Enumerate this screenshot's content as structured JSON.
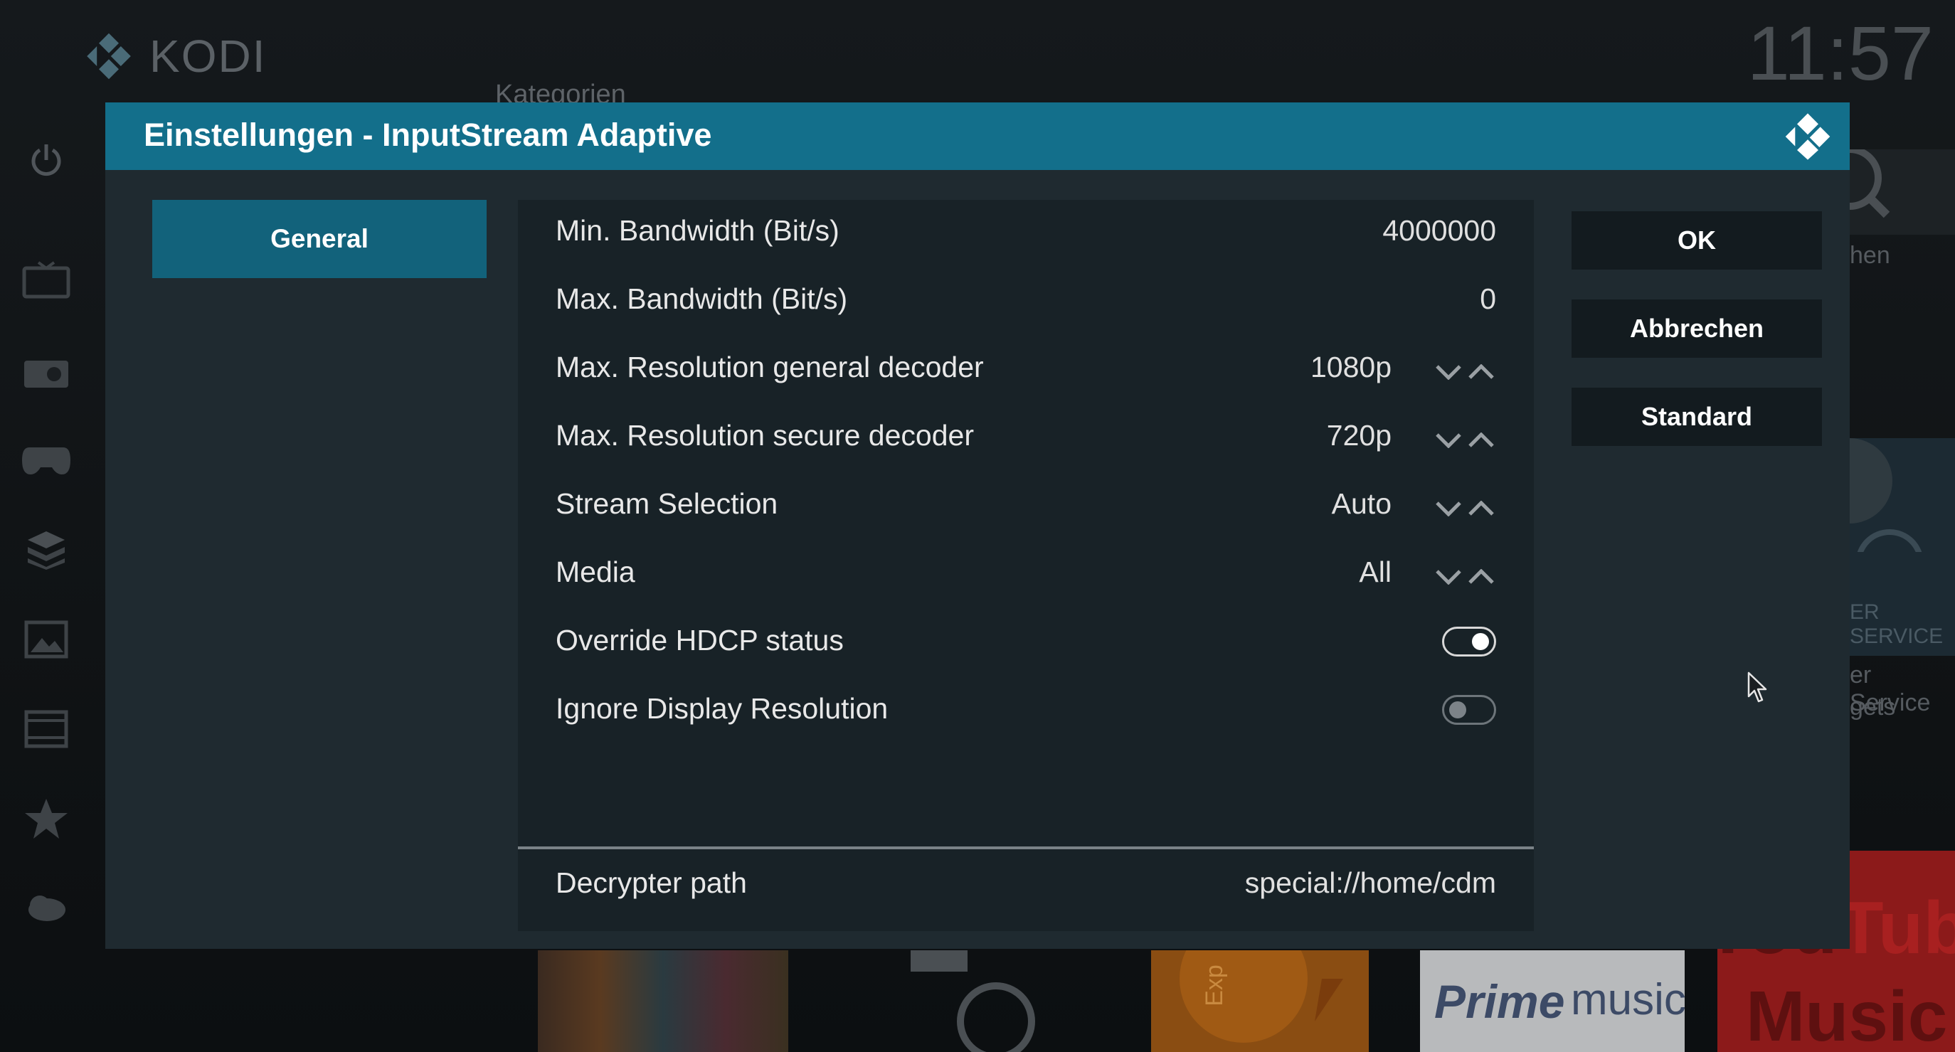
{
  "background": {
    "app_name": "KODI",
    "clock": "11:57",
    "category_label": "Kategorien",
    "right_snippets": [
      "hen",
      "ER SERVICE",
      "er Service",
      "gets"
    ],
    "tile_text": [
      "Prime",
      "music",
      "You",
      "Tube",
      "Music",
      "Exp"
    ]
  },
  "dialog": {
    "title": "Einstellungen - InputStream Adaptive",
    "logo_icon": "kodi-logo-icon",
    "categories": [
      {
        "label": "General",
        "selected": true
      }
    ],
    "settings": [
      {
        "label": "Min. Bandwidth (Bit/s)",
        "value": "4000000",
        "type": "text"
      },
      {
        "label": "Max. Bandwidth (Bit/s)",
        "value": "0",
        "type": "text"
      },
      {
        "label": "Max. Resolution general decoder",
        "value": "1080p",
        "type": "spinner"
      },
      {
        "label": "Max. Resolution secure decoder",
        "value": "720p",
        "type": "spinner"
      },
      {
        "label": "Stream Selection",
        "value": "Auto",
        "type": "spinner"
      },
      {
        "label": "Media",
        "value": "All",
        "type": "spinner"
      },
      {
        "label": "Override HDCP status",
        "value": true,
        "type": "toggle"
      },
      {
        "label": "Ignore Display Resolution",
        "value": false,
        "type": "toggle"
      },
      {
        "label": "Decrypter path",
        "value": "special://home/cdm",
        "type": "text"
      }
    ],
    "buttons": {
      "ok": "OK",
      "cancel": "Abbrechen",
      "default": "Standard"
    }
  },
  "colors": {
    "header": "#136f8b",
    "selected_category": "#12627b",
    "dialog_bg": "#1f2a30",
    "panel_bg": "#182227",
    "button_bg": "#131b1f"
  }
}
